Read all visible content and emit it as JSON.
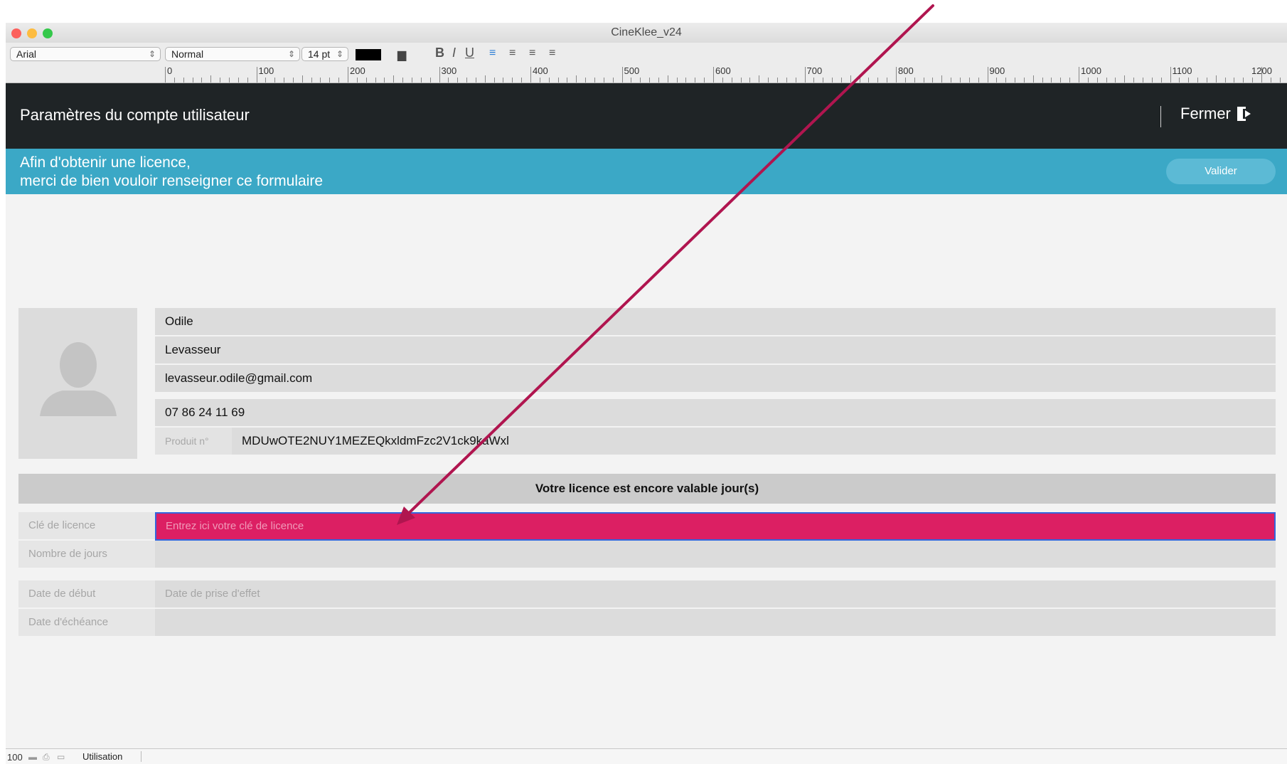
{
  "window": {
    "title": "CineKlee_v24"
  },
  "toolbar": {
    "font": "Arial",
    "style": "Normal",
    "size": "14 pt",
    "bold_label": "B",
    "italic_label": "I",
    "underline_label": "U"
  },
  "ruler": {
    "labels": [
      "0",
      "100",
      "200",
      "300",
      "400",
      "500",
      "600",
      "700",
      "800",
      "900",
      "1000",
      "1100",
      "1200"
    ]
  },
  "header": {
    "title": "Paramètres du compte utilisateur",
    "close_label": "Fermer"
  },
  "banner": {
    "line1": "Afin d'obtenir une licence,",
    "line2": "merci de bien vouloir renseigner ce formulaire",
    "validate_label": "Valider"
  },
  "profile": {
    "first_name": "Odile",
    "last_name": "Levasseur",
    "email": "levasseur.odile@gmail.com",
    "phone": "07 86 24 11 69",
    "product_label": "Produit n°",
    "product_value": "MDUwOTE2NUY1MEZEQkxldmFzc2V1ck9kaWxl"
  },
  "license": {
    "status": "Votre licence est encore valable  jour(s)",
    "key_label": "Clé de licence",
    "key_placeholder": "Entrez ici votre clé de licence",
    "days_label": "Nombre de jours",
    "start_label": "Date de début",
    "start_placeholder": "Date de prise d'effet",
    "end_label": "Date d'échéance"
  },
  "statusbar": {
    "zoom": "100",
    "mode": "Utilisation"
  },
  "colors": {
    "header_bg": "#1f2426",
    "banner_bg": "#3ba8c6",
    "license_input_bg": "#dc1f63",
    "annotation_arrow": "#b0154f"
  }
}
